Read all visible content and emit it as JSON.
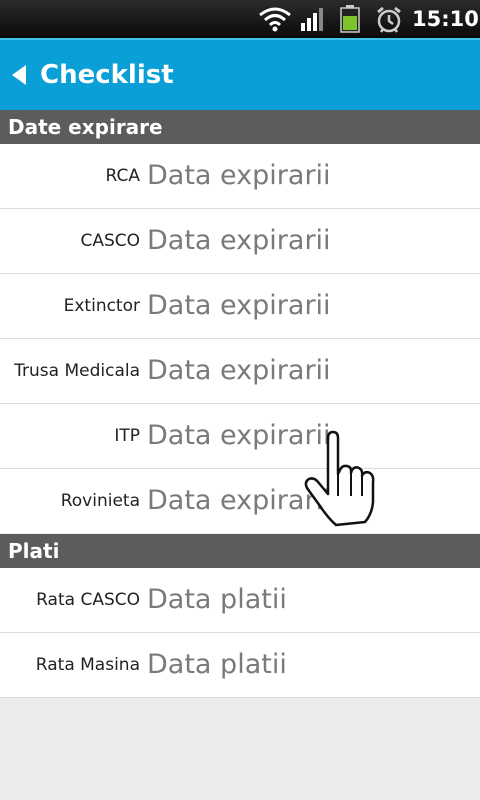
{
  "status_bar": {
    "time": "15:10",
    "icons": [
      "wifi-icon",
      "signal-icon",
      "battery-icon",
      "alarm-icon"
    ],
    "battery_color": "#7dc42a"
  },
  "action_bar": {
    "title": "Checklist",
    "color": "#0a9fd6"
  },
  "sections": [
    {
      "header": "Date expirare",
      "rows": [
        {
          "label": "RCA",
          "placeholder": "Data expirarii"
        },
        {
          "label": "CASCO",
          "placeholder": "Data expirarii"
        },
        {
          "label": "Extinctor",
          "placeholder": "Data expirarii"
        },
        {
          "label": "Trusa Medicala",
          "placeholder": "Data expirarii"
        },
        {
          "label": "ITP",
          "placeholder": "Data expirarii"
        },
        {
          "label": "Rovinieta",
          "placeholder": "Data expirarii"
        }
      ]
    },
    {
      "header": "Plati",
      "rows": [
        {
          "label": "Rata CASCO",
          "placeholder": "Data platii"
        },
        {
          "label": "Rata Masina",
          "placeholder": "Data platii"
        }
      ]
    }
  ]
}
